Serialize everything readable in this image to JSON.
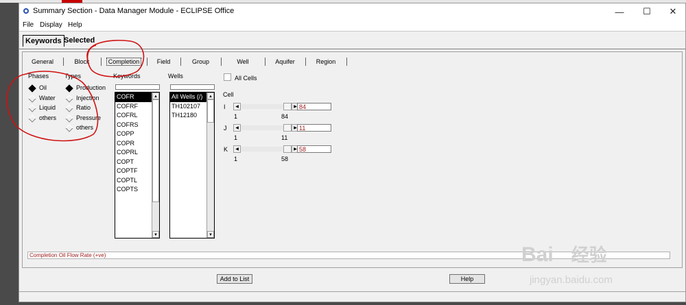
{
  "window": {
    "title": "Summary Section - Data Manager Module - ECLIPSE Office"
  },
  "menu": [
    "File",
    "Display",
    "Help"
  ],
  "primary_tabs": [
    "Keywords",
    "Selected"
  ],
  "section_tabs": [
    "General",
    "Block",
    "Completion",
    "Field",
    "Group",
    "Well",
    "Aquifer",
    "Region"
  ],
  "phases": {
    "header": "Phases",
    "options": [
      "Oil",
      "Water",
      "Liquid",
      "others"
    ],
    "selected": "Oil"
  },
  "types": {
    "header": "Types",
    "options": [
      "Production",
      "Injection",
      "Ratio",
      "Pressure",
      "others"
    ],
    "selected": "Production"
  },
  "keywords": {
    "header": "Keywords",
    "filter": "",
    "items": [
      "COFR",
      "COFRF",
      "COFRL",
      "COFRS",
      "COPP",
      "COPR",
      "COPRL",
      "COPT",
      "COPTF",
      "COPTL",
      "COPTS"
    ],
    "selected": "COFR"
  },
  "wells": {
    "header": "Wells",
    "filter": "",
    "items": [
      "All Wells (/)",
      "TH102107",
      "TH12180"
    ],
    "selected": "All Wells (/)"
  },
  "all_cells": {
    "label": "All Cells",
    "checked": false
  },
  "cell": {
    "header": "Cell",
    "rows": [
      {
        "axis": "I",
        "min": "1",
        "max": "84",
        "value": "84"
      },
      {
        "axis": "J",
        "min": "1",
        "max": "11",
        "value": "11"
      },
      {
        "axis": "K",
        "min": "1",
        "max": "58",
        "value": "58"
      }
    ]
  },
  "description": "Completion Oil Flow Rate (+ve)",
  "buttons": {
    "add_to_list": "Add to List",
    "help": "Help"
  },
  "window_controls": {
    "minimize": "—",
    "maximize": "☐",
    "close": "✕"
  },
  "arrows": {
    "left": "◀",
    "right": "▶",
    "up": "▲",
    "down": "▼"
  },
  "watermark": {
    "brand": "Bai",
    "brand_cn": "经验",
    "url": "jingyan.baidu.com"
  },
  "colors": {
    "value_text": "#a02020",
    "annotation": "#d01010"
  }
}
